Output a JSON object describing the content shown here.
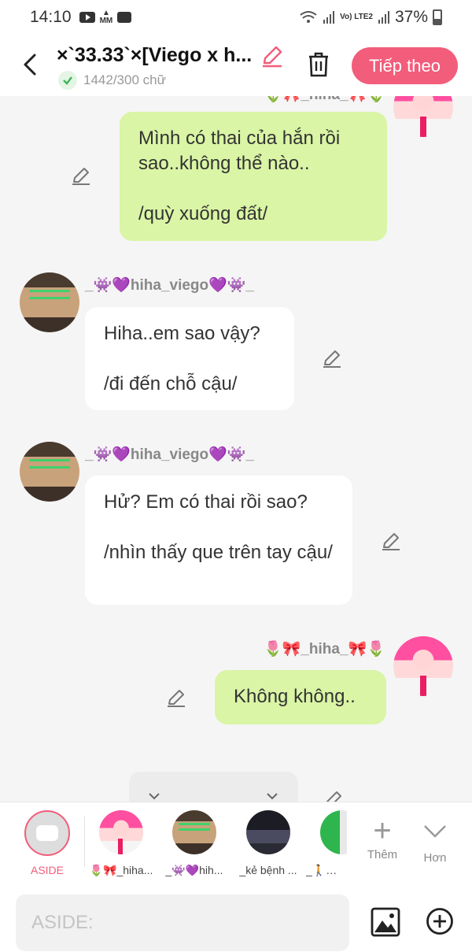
{
  "status_bar": {
    "time": "14:10",
    "battery": "37%",
    "network": "Vo) LTE2"
  },
  "header": {
    "title": "×`33.33`×[Viego x h...",
    "word_count": "1442/300 chữ",
    "next_label": "Tiếp theo"
  },
  "messages": [
    {
      "side": "right",
      "speaker": "🌷🎀_hiha_🎀🌷",
      "text": "Mình có thai của hắn rồi sao..không thể nào..\n\n/quỳ xuống đất/"
    },
    {
      "side": "left",
      "speaker": "_👾💜hiha_viego💜👾_",
      "text": "Hiha..em sao vậy?\n\n/đi đến chỗ cậu/"
    },
    {
      "side": "left",
      "speaker": "_👾💜hiha_viego💜👾_",
      "text": "Hử? Em có thai rồi sao?\n\n/nhìn thấy que trên tay cậu/"
    },
    {
      "side": "right",
      "speaker": "🌷🎀_hiha_🎀🌷",
      "text": "Không không.."
    }
  ],
  "character_bar": {
    "aside_label": "ASIDE",
    "characters": [
      {
        "name": "🌷🎀_hiha..."
      },
      {
        "name": "_👾💜hih..."
      },
      {
        "name": "_kẻ bệnh ..."
      },
      {
        "name": "_🚶🕸..."
      }
    ],
    "add_label": "Thêm",
    "more_label": "Hơn"
  },
  "input": {
    "placeholder": "ASIDE:"
  },
  "colors": {
    "accent": "#f25d7b",
    "my_bubble": "#d9f5a5",
    "other_bubble": "#ffffff",
    "background": "#f5f5f5"
  },
  "icons": [
    "back-arrow-icon",
    "edit-pencil-icon",
    "check-icon",
    "trash-icon",
    "image-icon",
    "add-circle-icon",
    "plus-icon",
    "chevron-down-icon"
  ]
}
